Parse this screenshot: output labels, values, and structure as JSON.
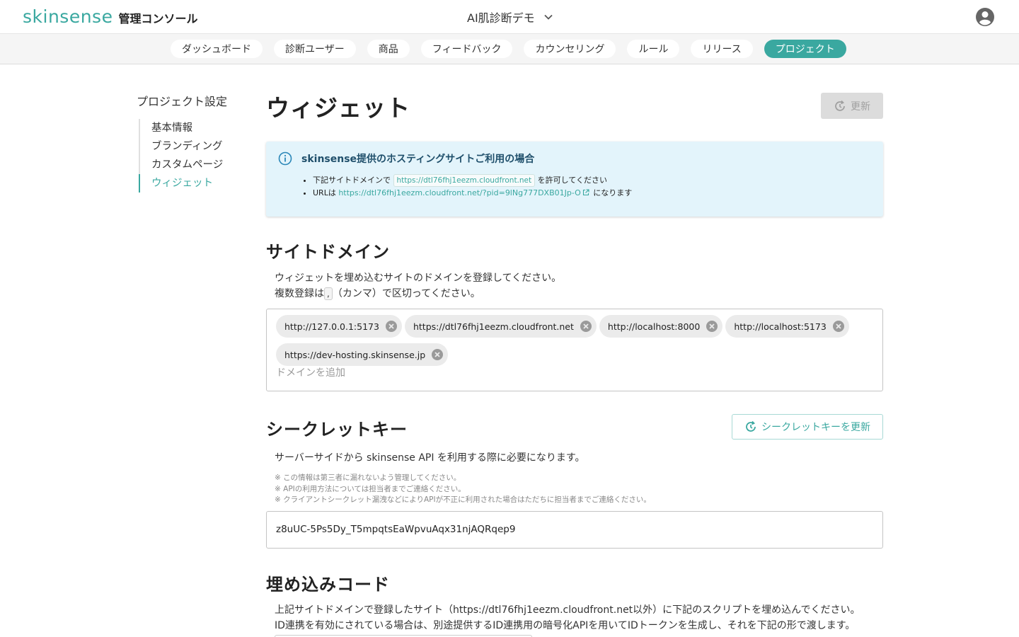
{
  "header": {
    "brand": "skinsense",
    "subtitle": "管理コンソール",
    "project": "AI肌診断デモ"
  },
  "tabs": [
    {
      "label": "ダッシュボード",
      "active": false
    },
    {
      "label": "診断ユーザー",
      "active": false
    },
    {
      "label": "商品",
      "active": false
    },
    {
      "label": "フィードバック",
      "active": false
    },
    {
      "label": "カウンセリング",
      "active": false
    },
    {
      "label": "ルール",
      "active": false
    },
    {
      "label": "リリース",
      "active": false
    },
    {
      "label": "プロジェクト",
      "active": true
    }
  ],
  "sidebar": {
    "title": "プロジェクト設定",
    "items": [
      {
        "label": "基本情報",
        "active": false
      },
      {
        "label": "ブランディング",
        "active": false
      },
      {
        "label": "カスタムページ",
        "active": false
      },
      {
        "label": "ウィジェット",
        "active": true
      }
    ]
  },
  "page": {
    "title": "ウィジェット",
    "refresh_label": "更新"
  },
  "info": {
    "title": "skinsense提供のホスティングサイトご利用の場合",
    "line1_pre": "下記サイトドメインで",
    "line1_code": "https://dtl76fhj1eezm.cloudfront.net",
    "line1_post": "を許可してください",
    "line2_pre": "URLは",
    "line2_link": "https://dtl76fhj1eezm.cloudfront.net/?pid=9lNg777DXB01Jp-O",
    "line2_post": "になります"
  },
  "site_domain": {
    "heading": "サイトドメイン",
    "desc1": "ウィジェットを埋め込むサイトのドメインを登録してください。",
    "desc2_pre": "複数登録は",
    "desc2_code": ",",
    "desc2_post": "（カンマ）で区切ってください。",
    "domains": [
      "http://127.0.0.1:5173",
      "https://dtl76fhj1eezm.cloudfront.net",
      "http://localhost:8000",
      "http://localhost:5173",
      "https://dev-hosting.skinsense.jp"
    ],
    "placeholder": "ドメインを追加"
  },
  "secret": {
    "heading": "シークレットキー",
    "refresh_label": "シークレットキーを更新",
    "desc": "サーバーサイドから skinsense API を利用する際に必要になります。",
    "notes": [
      "※ この情報は第三者に漏れないよう管理してください。",
      "※ APIの利用方法については担当者までご連絡ください。",
      "※ クライアントシークレット漏洩などによりAPIが不正に利用された場合はただちに担当者までご連絡ください。"
    ],
    "value": "z8uUC-5Ps5Dy_T5mpqtsEaWpvuAqx31njAQRqep9"
  },
  "embed": {
    "heading": "埋め込みコード",
    "desc1": "上記サイトドメインで登録したサイト（https://dtl76fhj1eezm.cloudfront.net以外）に下記のスクリプトを埋め込んでください。",
    "desc2": "ID連携を有効にされている場合は、別途提供するID連携用の暗号化APIを用いてIDトークンを生成し、それを下記の形で渡します。"
  },
  "colors": {
    "accent": "#3aa8a0",
    "info_bg": "#e3f4fb"
  }
}
